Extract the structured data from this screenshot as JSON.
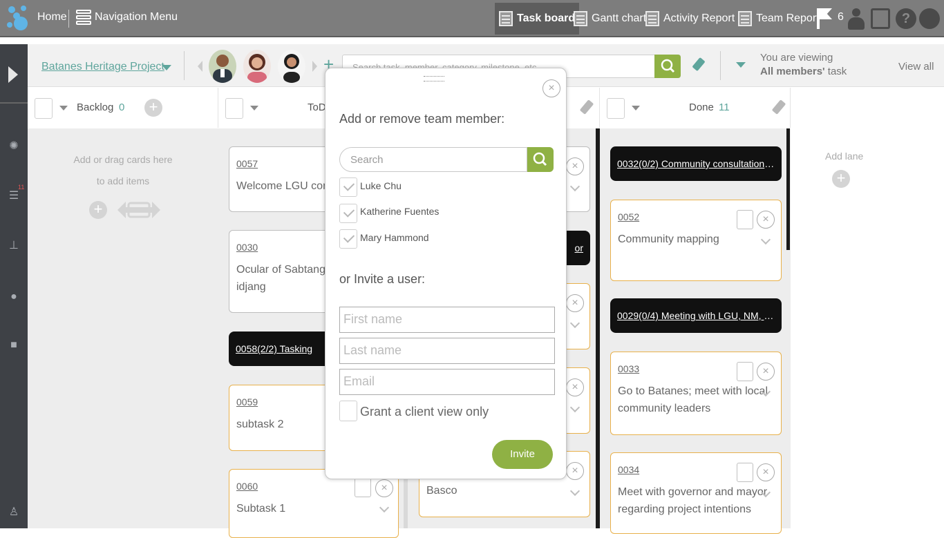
{
  "topbar": {
    "home": "Home",
    "nav_menu": "Navigation Menu",
    "tabs": [
      "Task board",
      "Gantt chart",
      "Activity Report",
      "Team Report"
    ],
    "flag_count": "6"
  },
  "rail": {
    "notification_badge": "11"
  },
  "project": {
    "name": "Batanes Heritage Project",
    "search_placeholder": "Search task, member, category, milestone, etc.",
    "viewing_line1": "You are viewing",
    "viewing_line2_bold": "All members'",
    "viewing_line2_rest": " task",
    "view_all": "View all"
  },
  "lanes": {
    "backlog": {
      "title": "Backlog",
      "count": "0",
      "empty_line1": "Add or drag cards here",
      "empty_line2": "to add items"
    },
    "todo": {
      "title": "ToDo"
    },
    "done": {
      "title": "Done",
      "count": "11"
    },
    "add_lane": "Add lane"
  },
  "cards": {
    "todo": [
      {
        "id": "0057",
        "title": "Welcome LGU committee"
      },
      {
        "id": "0030",
        "title": "Ocular of Sabtang Island",
        "title2": "idjang"
      },
      {
        "id": "0058(2/2) Tasking"
      },
      {
        "id": "0059",
        "title": "subtask 2"
      },
      {
        "id": "0060",
        "title": "Subtask 1"
      }
    ],
    "third_lane_bottom": "Basco",
    "third_lane_dark_fragment": "or",
    "done": [
      {
        "id": "0032(0/2) Community consultation a..."
      },
      {
        "id": "0052",
        "title": "Community mapping"
      },
      {
        "id": "0029(0/4) Meeting with LGU, NM, N..."
      },
      {
        "id": "0033",
        "title": "Go to Batanes; meet with local",
        "title2": "community leaders"
      },
      {
        "id": "0034",
        "title": "Meet with governor and mayor",
        "title2": "regarding project intentions"
      }
    ]
  },
  "modal": {
    "title": "Add or remove team member:",
    "search_placeholder": "Search",
    "members": [
      "Luke Chu",
      "Katherine Fuentes",
      "Mary Hammond"
    ],
    "invite_title": "or Invite a user:",
    "first_name_placeholder": "First name",
    "last_name_placeholder": "Last name",
    "email_placeholder": "Email",
    "client_view_label": "Grant a client view only",
    "invite_button": "Invite"
  },
  "colors": {
    "accent_green": "#8fb144",
    "teal": "#5ea59c",
    "card_orange": "#e8b04a"
  }
}
